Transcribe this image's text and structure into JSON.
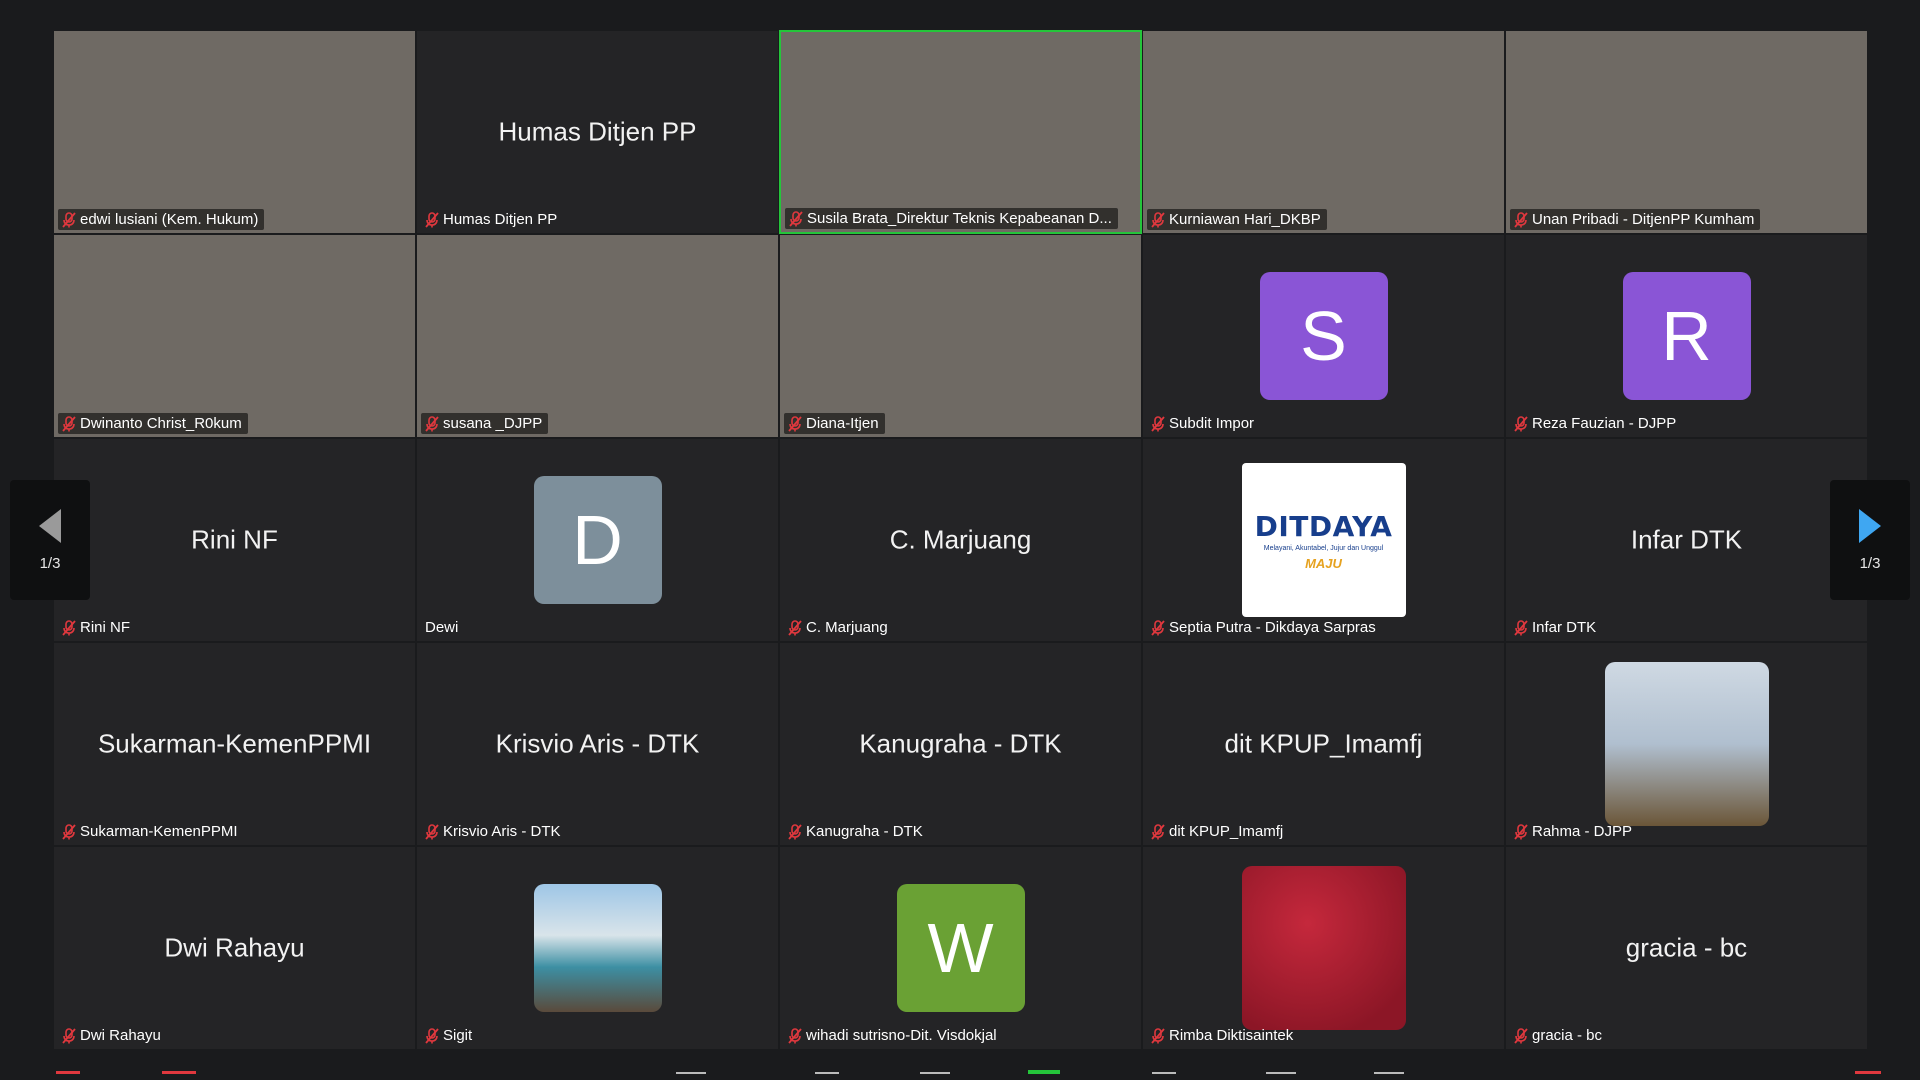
{
  "tiles": [
    {
      "type": "video",
      "style": "v1",
      "label": "edwi lusiani (Kem. Hukum)"
    },
    {
      "type": "name",
      "center": "Humas Ditjen PP",
      "label": "Humas Ditjen PP"
    },
    {
      "type": "video",
      "style": "v2",
      "label": "Susila Brata_Direktur Teknis Kepabeanan D...",
      "active": true
    },
    {
      "type": "video",
      "style": "v3",
      "label": "Kurniawan Hari_DKBP"
    },
    {
      "type": "video",
      "style": "v4",
      "label": "Unan Pribadi - DitjenPP Kumham"
    },
    {
      "type": "video",
      "style": "v5",
      "label": "Dwinanto Christ_R0kum"
    },
    {
      "type": "video",
      "style": "v6",
      "label": "susana _DJPP"
    },
    {
      "type": "video",
      "style": "v7",
      "label": "Diana-Itjen"
    },
    {
      "type": "avatar",
      "letter": "S",
      "avatar_style": "av-purple",
      "label": "Subdit Impor"
    },
    {
      "type": "avatar",
      "letter": "R",
      "avatar_style": "av-purple",
      "label": "Reza Fauzian - DJPP"
    },
    {
      "type": "name",
      "center": "Rini NF",
      "label": "Rini NF"
    },
    {
      "type": "avatar",
      "letter": "D",
      "avatar_style": "av-gray",
      "label": "Dewi",
      "no_mic": true
    },
    {
      "type": "name",
      "center": "C. Marjuang",
      "label": "C. Marjuang"
    },
    {
      "type": "logo",
      "label": "Septia Putra - Dikdaya Sarpras"
    },
    {
      "type": "name",
      "center": "Infar DTK",
      "label": "Infar DTK"
    },
    {
      "type": "name",
      "center": "Sukarman-KemenPPMI",
      "label": "Sukarman-KemenPPMI"
    },
    {
      "type": "name",
      "center": "Krisvio Aris - DTK",
      "label": "Krisvio Aris - DTK"
    },
    {
      "type": "name",
      "center": "Kanugraha - DTK",
      "label": "Kanugraha - DTK"
    },
    {
      "type": "name",
      "center": "dit KPUP_Imamfj",
      "label": "dit KPUP_Imamfj"
    },
    {
      "type": "avatar",
      "letter": "",
      "avatar_style": "av-photo",
      "label": "Rahma - DJPP"
    },
    {
      "type": "name",
      "center": "Dwi Rahayu",
      "label": "Dwi Rahayu"
    },
    {
      "type": "avatar",
      "letter": "",
      "avatar_style": "av-sea",
      "label": "Sigit"
    },
    {
      "type": "avatar",
      "letter": "W",
      "avatar_style": "av-green",
      "label": "wihadi sutrisno-Dit. Visdokjal"
    },
    {
      "type": "avatar",
      "letter": "",
      "avatar_style": "av-red",
      "label": "Rimba Diktisaintek"
    },
    {
      "type": "name",
      "center": "gracia - bc",
      "label": "gracia - bc"
    }
  ],
  "logo": {
    "line1": "DITDAYA",
    "line2": "Melayani, Akuntabel, Jujur dan Unggul",
    "line3": "MAJU"
  },
  "nav": {
    "left_page": "1/3",
    "right_page": "1/3"
  },
  "colors": {
    "active_border": "#24c53a",
    "mic_muted": "#e0383e",
    "nav_arrow_left": "#9a9a9a",
    "nav_arrow_right": "#3fa7f2"
  }
}
